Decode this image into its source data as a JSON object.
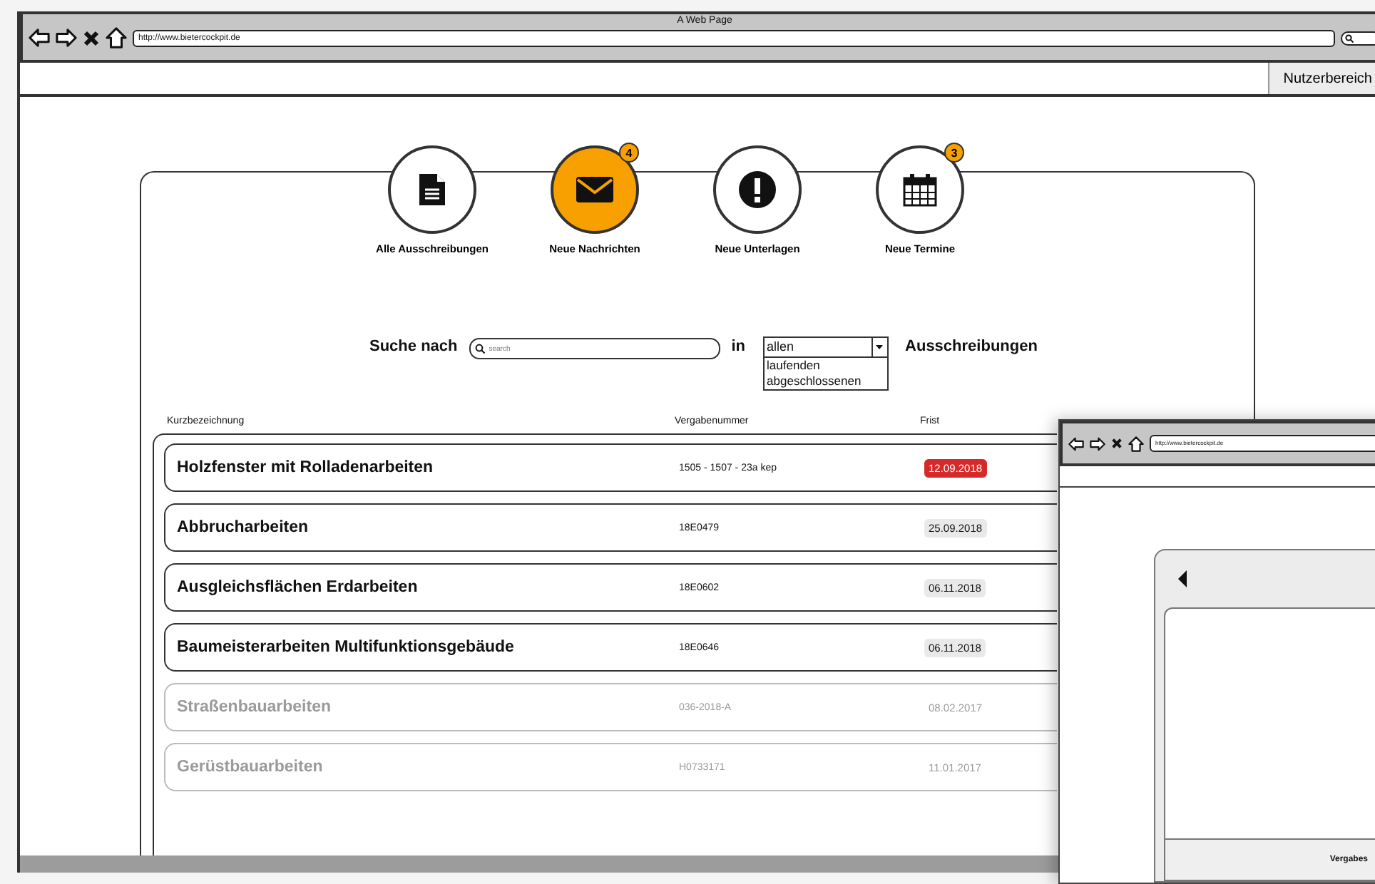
{
  "window": {
    "title": "A Web Page",
    "url": "http://www.bietercockpit.de"
  },
  "top_bar": {
    "button": "Nutzerbereich"
  },
  "nav": [
    {
      "kind": "document",
      "label": "Alle Ausschreibungen",
      "selected": false
    },
    {
      "kind": "envelope",
      "label": "Neue Nachrichten",
      "selected": true,
      "badge": "4"
    },
    {
      "kind": "alert",
      "label": "Neue Unterlagen",
      "selected": false
    },
    {
      "kind": "calendar",
      "label": "Neue Termine",
      "selected": false,
      "badge": "3"
    }
  ],
  "search": {
    "label": "Suche nach",
    "placeholder": "search",
    "in_label": "in",
    "select": {
      "value": "allen",
      "expanded": true,
      "options": [
        "laufenden",
        "abgeschlossenen"
      ]
    },
    "suffix": "Ausschreibungen"
  },
  "table": {
    "columns": [
      "Kurzbezeichnung",
      "Vergabenummer",
      "Frist"
    ],
    "rows": [
      {
        "title": "Holzfenster mit Rolladenarbeiten",
        "number": "1505 - 1507 - 23a kep",
        "deadline": "12.09.2018",
        "active": true,
        "overdue": true
      },
      {
        "title": "Abbrucharbeiten",
        "number": "18E0479",
        "deadline": "25.09.2018",
        "active": true,
        "overdue": false
      },
      {
        "title": "Ausgleichsflächen Erdarbeiten",
        "number": "18E0602",
        "deadline": "06.11.2018",
        "active": true,
        "overdue": false
      },
      {
        "title": "Baumeisterarbeiten Multifunktionsgebäude",
        "number": "18E0646",
        "deadline": "06.11.2018",
        "active": true,
        "overdue": false
      },
      {
        "title": "Straßenbauarbeiten",
        "number": "036-2018-A",
        "deadline": "08.02.2017",
        "active": false,
        "overdue": false
      },
      {
        "title": "Gerüstbauarbeiten",
        "number": "H0733171",
        "deadline": "11.01.2017",
        "active": false,
        "overdue": false
      }
    ]
  },
  "overlay_window": {
    "url": "http://www.bietercockpit.de",
    "footer_text": "Vergabes"
  }
}
